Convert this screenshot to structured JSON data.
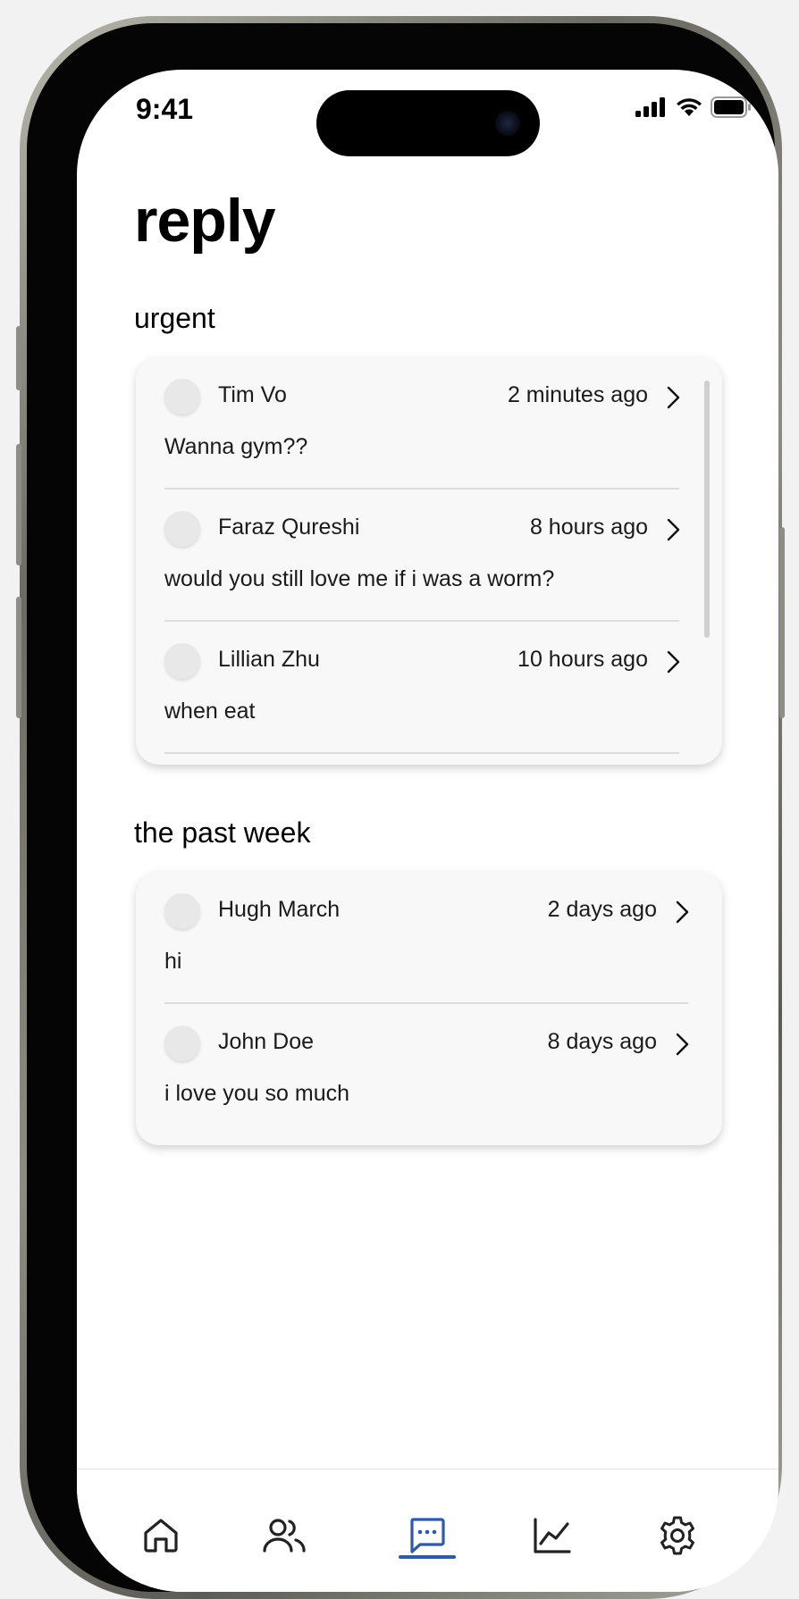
{
  "status_bar": {
    "time": "9:41"
  },
  "page": {
    "title": "reply"
  },
  "sections": [
    {
      "title": "urgent",
      "messages": [
        {
          "sender": "Tim Vo",
          "time": "2 minutes ago",
          "preview": "Wanna gym??"
        },
        {
          "sender": "Faraz Qureshi",
          "time": "8 hours ago",
          "preview": "would you still love me if i was a worm?"
        },
        {
          "sender": "Lillian Zhu",
          "time": "10 hours ago",
          "preview": "when eat"
        }
      ]
    },
    {
      "title": "the past week",
      "messages": [
        {
          "sender": "Hugh March",
          "time": "2 days ago",
          "preview": "hi"
        },
        {
          "sender": "John Doe",
          "time": "8 days ago",
          "preview": "i love you so much"
        }
      ]
    }
  ],
  "nav": {
    "items": [
      {
        "icon": "home-icon",
        "label": "home"
      },
      {
        "icon": "users-icon",
        "label": "people"
      },
      {
        "icon": "message-icon",
        "label": "reply",
        "active": true
      },
      {
        "icon": "chart-icon",
        "label": "stats"
      },
      {
        "icon": "gear-icon",
        "label": "settings"
      }
    ],
    "active_color": "#2e5aa8"
  }
}
